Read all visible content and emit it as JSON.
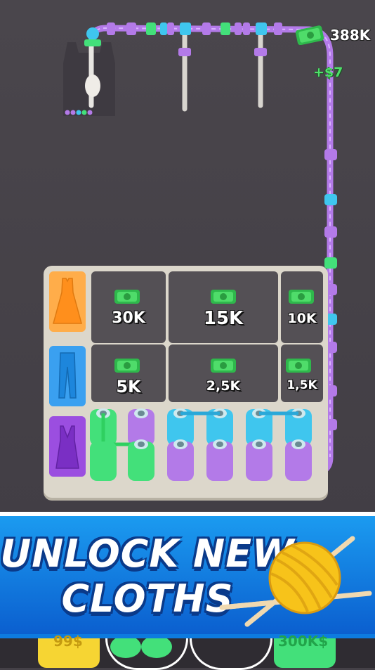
{
  "hud": {
    "money": "388K",
    "earn_popup": "+$7"
  },
  "shelf": {
    "rows": [
      {
        "cloth": "dress",
        "cloth_color": "#ff9f35",
        "slots": [
          {
            "price": "30K",
            "locked": true
          },
          {
            "price": "15K",
            "locked": true
          },
          {
            "price": "10K",
            "locked": true
          }
        ]
      },
      {
        "cloth": "jeans",
        "cloth_color": "#3aa0f0",
        "slots": [
          {
            "price": "5K",
            "locked": true
          },
          {
            "price": "2,5K",
            "locked": true
          },
          {
            "price": "1,5K",
            "locked": true
          }
        ]
      },
      {
        "cloth": "tank-top",
        "cloth_color": "#9b4ee0"
      }
    ]
  },
  "banner": {
    "line1": "UNLOCK NEW",
    "line2": "CLOTHS",
    "icon": "yarn-ball-icon"
  },
  "bottom_bar": {
    "left_label": "99$",
    "right_label": "300K$"
  },
  "colors": {
    "purple": "#b37ae8",
    "green": "#43e07a",
    "cyan": "#3fc6ee",
    "orange": "#ff9f35",
    "board": "#dcd7cb",
    "banner": "#1b8ae8"
  }
}
